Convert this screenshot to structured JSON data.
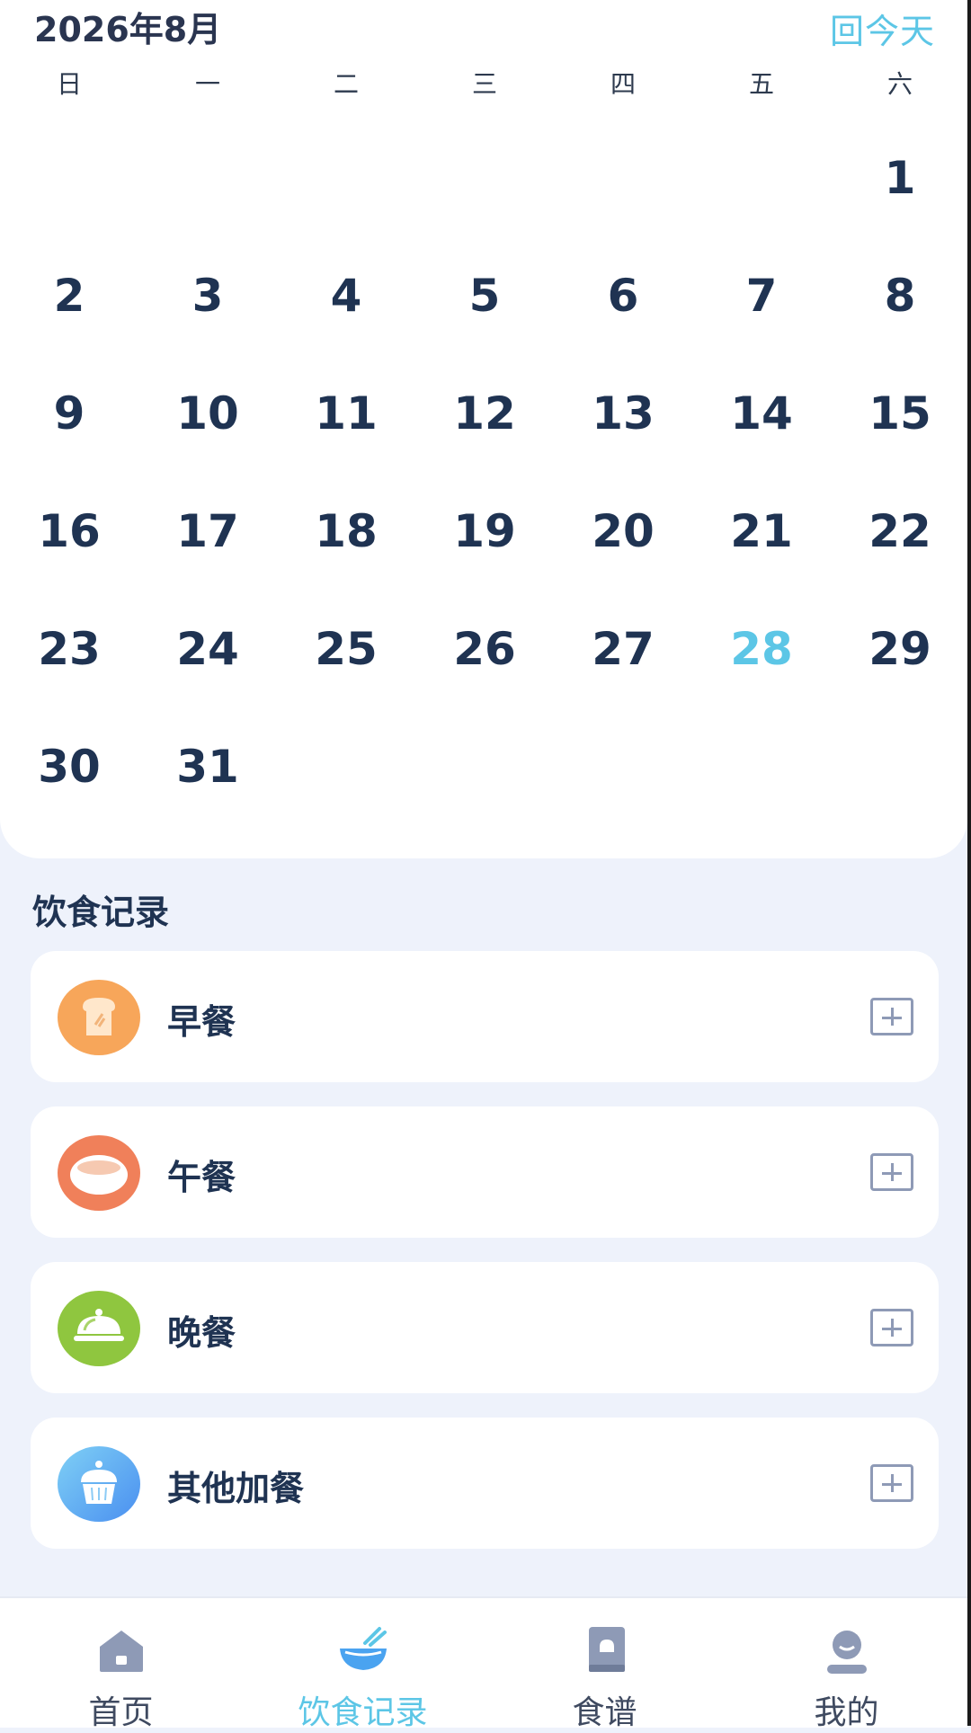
{
  "calendar": {
    "month_title": "2026年8月",
    "today_button": "回今天",
    "weekdays": [
      "日",
      "一",
      "二",
      "三",
      "四",
      "五",
      "六"
    ],
    "days": [
      "",
      "",
      "",
      "",
      "",
      "",
      "1",
      "2",
      "3",
      "4",
      "5",
      "6",
      "7",
      "8",
      "9",
      "10",
      "11",
      "12",
      "13",
      "14",
      "15",
      "16",
      "17",
      "18",
      "19",
      "20",
      "21",
      "22",
      "23",
      "24",
      "25",
      "26",
      "27",
      "28",
      "29",
      "30",
      "31",
      "",
      "",
      "",
      "",
      ""
    ],
    "today": "28",
    "accent_color": "#5cc6e6"
  },
  "diet": {
    "section_title": "饮食记录",
    "meals": [
      {
        "label": "早餐",
        "icon": "bread-icon",
        "color": "#f7a65a"
      },
      {
        "label": "午餐",
        "icon": "rice-bowl-icon",
        "color": "#f0805a"
      },
      {
        "label": "晚餐",
        "icon": "food-cloche-icon",
        "color": "#8fc63f"
      },
      {
        "label": "其他加餐",
        "icon": "cake-icon",
        "color": "#4aa3f0"
      }
    ]
  },
  "nav": {
    "items": [
      {
        "label": "首页",
        "icon": "home-icon"
      },
      {
        "label": "饮食记录",
        "icon": "bowl-icon"
      },
      {
        "label": "食谱",
        "icon": "recipe-book-icon"
      },
      {
        "label": "我的",
        "icon": "profile-icon"
      }
    ],
    "active": "饮食记录"
  }
}
